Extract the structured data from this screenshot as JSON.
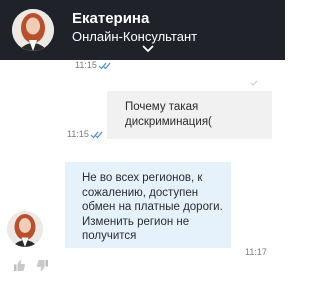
{
  "header": {
    "name": "Екатерина",
    "role": "Онлайн-Консультант"
  },
  "messages": [
    {
      "direction": "outgoing",
      "text": "Почему такая дискриминация(",
      "time": "11:15"
    },
    {
      "direction": "incoming",
      "text": "Не во всех регионов, к сожалению, доступен обмен на платные дороги. Изменить регион не получится",
      "time": "11:17"
    }
  ],
  "previous_time": "11:15",
  "colors": {
    "header_bg": "#1f2329",
    "incoming_bubble": "#e5f1fb",
    "outgoing_bubble": "#f1f1f1",
    "read_check": "#4a90d9"
  },
  "icons": [
    "chevron-down-icon",
    "double-check-icon",
    "thumb-up-icon",
    "thumb-down-icon",
    "avatar"
  ]
}
